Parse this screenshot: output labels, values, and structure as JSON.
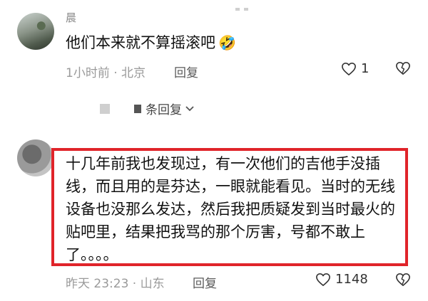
{
  "comments": [
    {
      "username": "晨",
      "text": "他们本来就不算摇滚吧",
      "emoji": "🤣",
      "meta": "1小时前 · 北京",
      "reply_label": "回复",
      "likes": "1",
      "sub_replies_label": "条回复"
    },
    {
      "text": "十几年前我也发现过，有一次他们的吉他手没插线，而且用的是芬达，一眼就能看见。当时的无线设备也没那么发达，然后我把质疑发到当时最火的贴吧里，结果把我骂的那个厉害，号都不敢上了。。。。",
      "meta": "昨天 23:23 · 山东",
      "reply_label": "回复",
      "likes": "1148"
    }
  ],
  "colors": {
    "highlight_border": "#e0242a",
    "meta_text": "#9a9a9a"
  },
  "icons": {
    "like": "heart-outline-icon",
    "dislike": "broken-heart-icon",
    "expand": "chevron-down-icon"
  }
}
